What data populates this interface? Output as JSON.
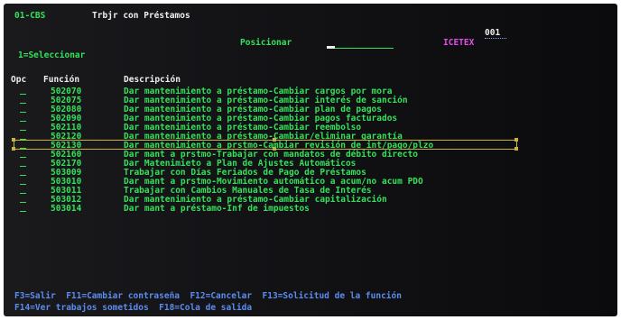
{
  "header": {
    "system_code": "01-CBS",
    "title": "Trbjr con Préstamos",
    "position_label": "Posicionar",
    "position_value": "",
    "company": "ICETEX",
    "page_number": "001"
  },
  "options_hint": "1=Seleccionar",
  "columns": {
    "opc": "Opc",
    "function": "Función",
    "description": "Descripción"
  },
  "rows": [
    {
      "code": "502070",
      "desc": "Dar mantenimiento a préstamo-Cambiar cargos por mora"
    },
    {
      "code": "502075",
      "desc": "Dar mantenimiento a préstamo-Cambiar interés de sanción"
    },
    {
      "code": "502080",
      "desc": "Dar mantenimiento a préstamo-Cambiar plan de pagos"
    },
    {
      "code": "502090",
      "desc": "Dar mantenimiento a préstamo-Cambiar pagos facturados"
    },
    {
      "code": "502110",
      "desc": "Dar mantenimiento a préstamo-Cambiar reembolso"
    },
    {
      "code": "502120",
      "desc": "Dar mantenimiento a préstamo-Cambiar/eliminar garantía"
    },
    {
      "code": "502130",
      "desc": "Dar mantenimiento a prstmo-Cambiar revisión de int/pago/plzo"
    },
    {
      "code": "502160",
      "desc": "Dar mant a prstmo-Trabajar con mandatos de débito directo"
    },
    {
      "code": "502170",
      "desc": "Dar Matenimieto a Plan de Ajustes Automáticos"
    },
    {
      "code": "503009",
      "desc": "Trabajar con Días Feriados de Pago de Préstamos"
    },
    {
      "code": "503010",
      "desc": "Dar mant a prstmo-Movimiento automático a acum/no acum PDO"
    },
    {
      "code": "503011",
      "desc": "Trabajar con Cambios Manuales de Tasa de Interés"
    },
    {
      "code": "503012",
      "desc": "Dar mantenimiento a préstamo-Cambiar capitalización"
    },
    {
      "code": "503014",
      "desc": "Dar mant a préstamo-Inf de impuestos"
    }
  ],
  "selected_row_index": 6,
  "function_keys": {
    "line1": "F3=Salir  F11=Cambiar contraseña  F12=Cancelar  F13=Solicitud de la función",
    "line2": "F14=Ver trabajos sometidos  F18=Cola de salida"
  },
  "colors": {
    "text_green": "#35e05a",
    "text_white": "#eeeeee",
    "text_blue": "#7ea8f0",
    "company_magenta": "#e24fe8",
    "selection_border": "#c9b23c",
    "background": "#141417"
  }
}
